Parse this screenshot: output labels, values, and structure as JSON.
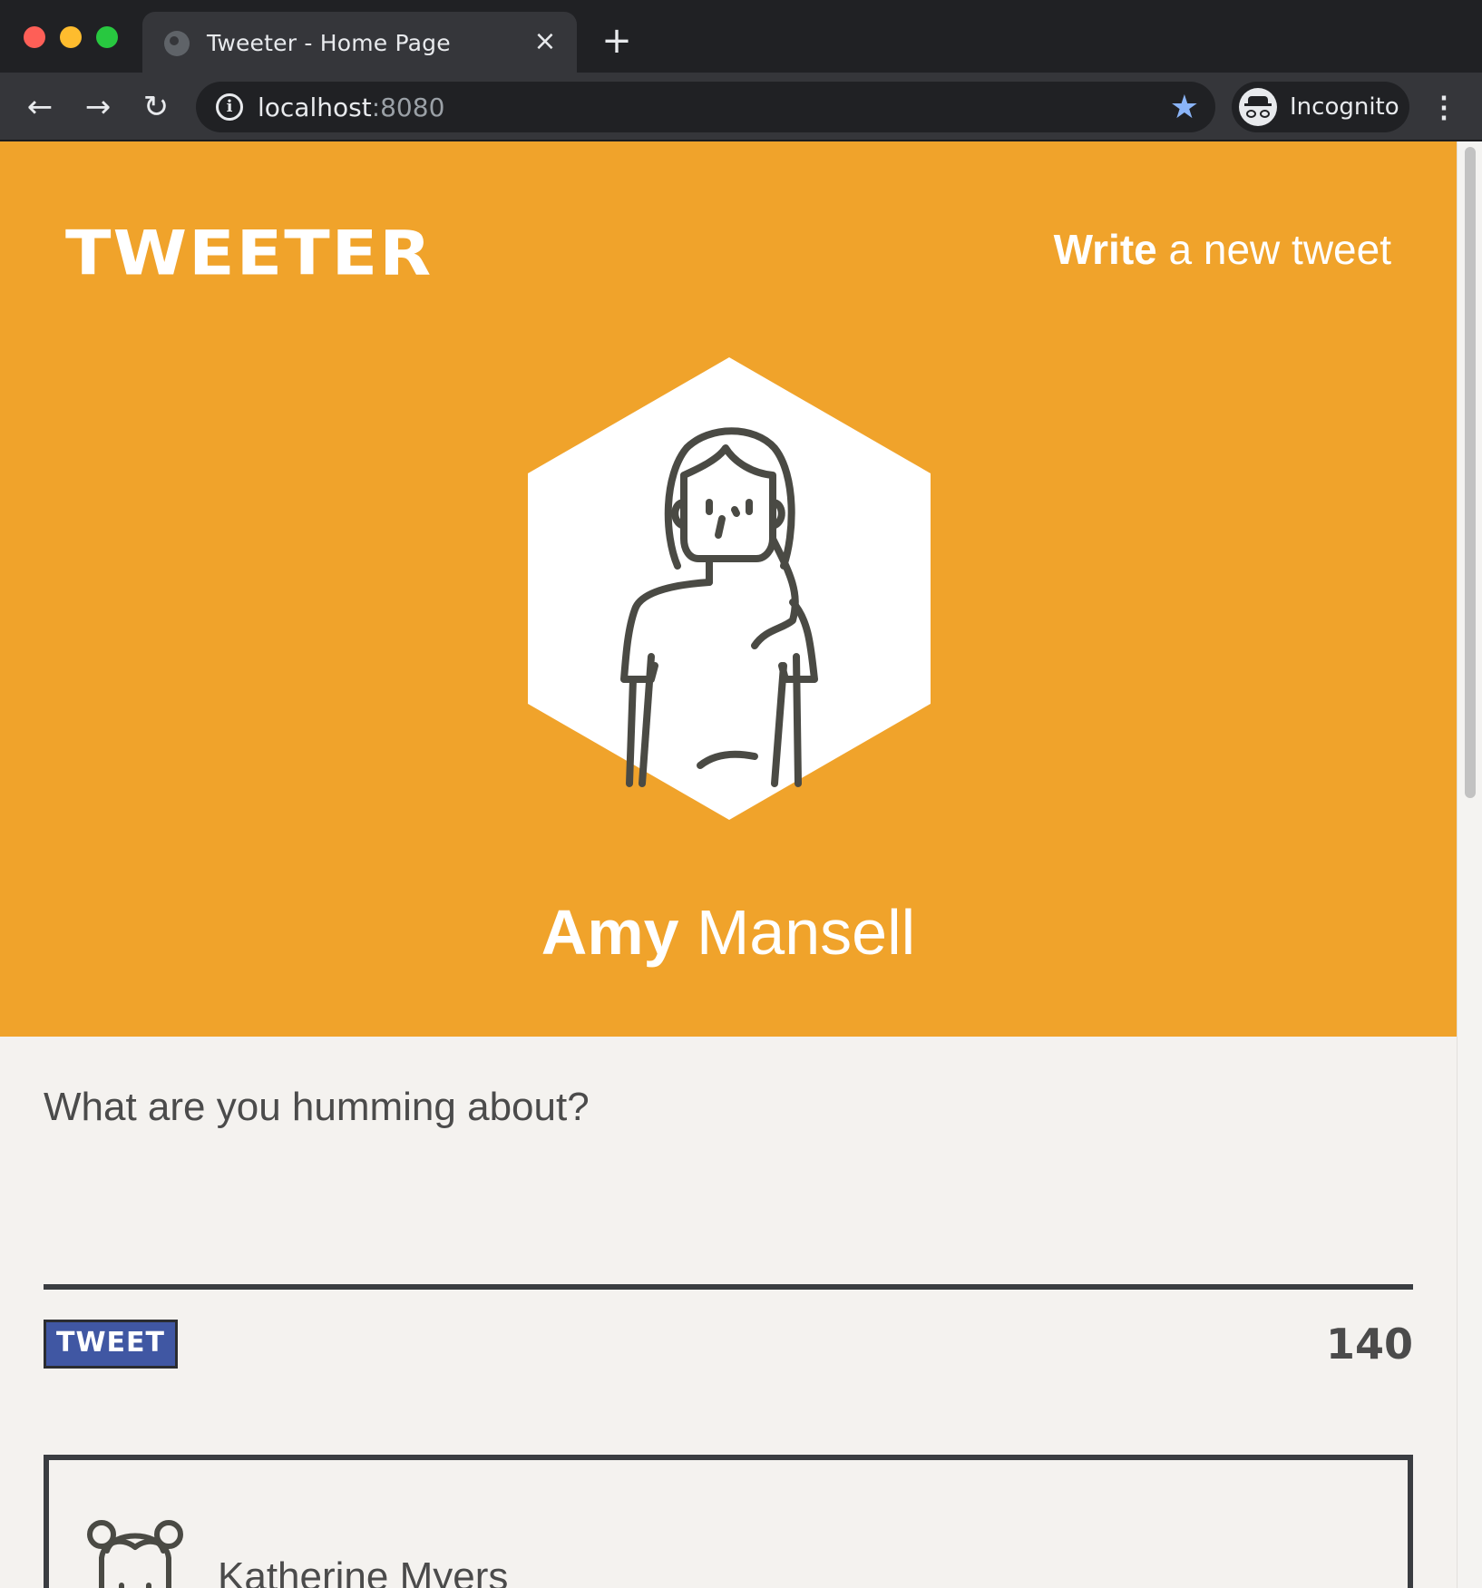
{
  "browser": {
    "tab_title": "Tweeter - Home Page",
    "tab_close_icon": "×",
    "new_tab_icon": "+",
    "back_icon": "←",
    "forward_icon": "→",
    "reload_icon": "↻",
    "url_host": "localhost",
    "url_port": ":8080",
    "bookmark_icon": "★",
    "profile_label": "Incognito",
    "menu_icon": "⋮"
  },
  "header": {
    "logo": "TWEETER",
    "write_bold": "Write",
    "write_rest": " a new tweet",
    "accent_color": "#f0a32b"
  },
  "profile": {
    "first_name": "Amy",
    "last_name": " Mansell",
    "avatar_icon": "woman-avatar-icon"
  },
  "compose": {
    "placeholder": "What are you humming about?",
    "value": "",
    "button_label": "TWEET",
    "button_color": "#4057a3",
    "counter": "140"
  },
  "tweets": [
    {
      "author": "Katherine Myers",
      "avatar_icon": "girl-avatar-icon"
    }
  ]
}
